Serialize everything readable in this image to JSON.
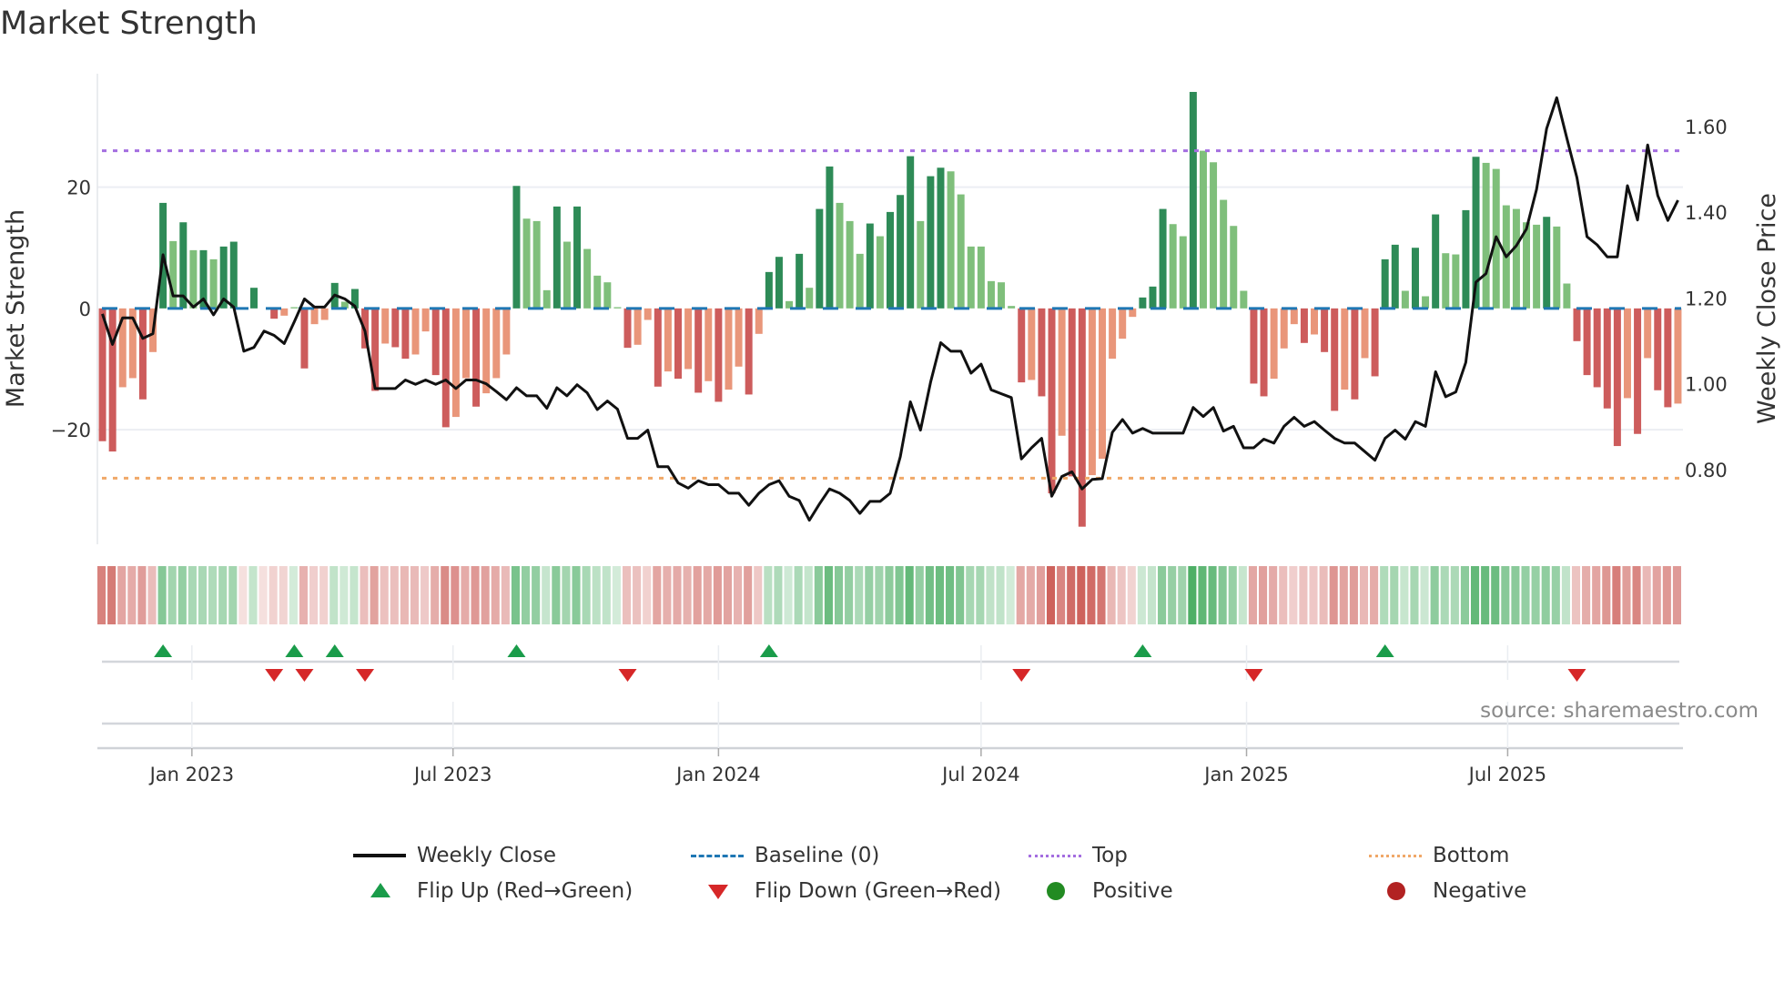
{
  "chart_data": {
    "type": "bar",
    "title": "Market Strength",
    "ylabel": "Market Strength",
    "ylabel_right": "Weekly Close Price",
    "x_start": "2022-10-31",
    "x_step_days": 7,
    "x_ticks": [
      {
        "label": "Jan 2023",
        "date": "2023-01-01"
      },
      {
        "label": "Jul 2023",
        "date": "2023-07-01"
      },
      {
        "label": "Jan 2024",
        "date": "2024-01-01"
      },
      {
        "label": "Jul 2024",
        "date": "2024-07-01"
      },
      {
        "label": "Jan 2025",
        "date": "2025-01-01"
      },
      {
        "label": "Jul 2025",
        "date": "2025-07-01"
      }
    ],
    "ylim": [
      -38.9,
      38.7
    ],
    "y_ticks": [
      {
        "value": 20,
        "label": "20"
      },
      {
        "value": 0,
        "label": "0"
      },
      {
        "value": -20,
        "label": "−20"
      }
    ],
    "ylim_right": [
      0.626,
      1.723
    ],
    "y_ticks_right": [
      {
        "value": 1.6,
        "label": "1.60"
      },
      {
        "value": 1.4,
        "label": "1.40"
      },
      {
        "value": 1.2,
        "label": "1.20"
      },
      {
        "value": 1.0,
        "label": "1.00"
      },
      {
        "value": 0.8,
        "label": "0.80"
      }
    ],
    "grid": true,
    "reference_lines": {
      "baseline": 0,
      "top": 26,
      "bottom": -28
    },
    "series": [
      {
        "name": "Market Strength",
        "values": [
          -21.9,
          -23.6,
          -13,
          -11.5,
          -15,
          -7.2,
          17.4,
          11.1,
          14.2,
          9.6,
          9.6,
          8.1,
          10.2,
          11,
          0,
          3.4,
          0,
          -1.7,
          -1.2,
          0.2,
          -9.9,
          -2.6,
          -1.9,
          4.2,
          1.1,
          3.2,
          -6.6,
          -13.6,
          -5.8,
          -6.4,
          -8.3,
          -7.6,
          -3.8,
          -11,
          -19.6,
          -17.9,
          -11.5,
          -16.2,
          -14,
          -11.5,
          -7.6,
          20.2,
          14.8,
          14.4,
          3,
          16.8,
          11,
          16.8,
          9.8,
          5.4,
          4.3,
          0.2,
          -6.5,
          -6,
          -1.9,
          -12.9,
          -10.4,
          -11.6,
          -10,
          -13.9,
          -12,
          -15.4,
          -13.4,
          -9.6,
          -14.2,
          -4.2,
          6,
          8.5,
          1.2,
          9,
          3.4,
          16.4,
          23.4,
          17.4,
          14.4,
          9,
          14,
          11.9,
          15.9,
          18.7,
          25.1,
          14.4,
          21.8,
          23.2,
          22.6,
          18.8,
          10.2,
          10.2,
          4.5,
          4.3,
          0.4,
          -12.2,
          -11.8,
          -14.5,
          -30.5,
          -21,
          -27.7,
          -36,
          -27.5,
          -24.8,
          -8.3,
          -5,
          -1.4,
          1.8,
          3.6,
          16.4,
          13.9,
          11.9,
          35.7,
          26,
          24.1,
          17.9,
          13.6,
          2.9,
          -12.4,
          -14.5,
          -11.6,
          -6.6,
          -2.6,
          -5.7,
          -4.3,
          -7.2,
          -16.9,
          -13.4,
          -15,
          -8.2,
          -11.2,
          8.1,
          10.5,
          2.9,
          10,
          2,
          15.5,
          9.1,
          8.9,
          16.2,
          25,
          24,
          23,
          17,
          16.4,
          14.2,
          13.8,
          15.1,
          13.5,
          4.1,
          -5.4,
          -11,
          -13,
          -16.5,
          -22.7,
          -14.8,
          -20.7,
          -8.2,
          -13.5,
          -16.3,
          -15.7
        ],
        "strong": [
          1,
          1,
          0,
          0,
          1,
          0,
          1,
          0,
          1,
          0,
          1,
          0,
          1,
          1,
          0,
          1,
          0,
          1,
          0,
          0,
          1,
          0,
          0,
          1,
          0,
          1,
          1,
          1,
          0,
          1,
          1,
          0,
          0,
          1,
          1,
          0,
          0,
          1,
          0,
          0,
          0,
          1,
          0,
          0,
          0,
          1,
          0,
          1,
          0,
          0,
          0,
          0,
          1,
          0,
          0,
          1,
          0,
          1,
          0,
          1,
          0,
          1,
          0,
          0,
          1,
          0,
          1,
          1,
          0,
          1,
          0,
          1,
          1,
          0,
          0,
          0,
          1,
          0,
          1,
          1,
          1,
          0,
          1,
          1,
          0,
          0,
          0,
          0,
          0,
          0,
          0,
          1,
          0,
          1,
          1,
          0,
          1,
          1,
          0,
          0,
          0,
          0,
          0,
          1,
          1,
          1,
          0,
          0,
          1,
          0,
          0,
          0,
          0,
          0,
          1,
          1,
          0,
          0,
          0,
          1,
          0,
          1,
          1,
          0,
          1,
          0,
          1,
          1,
          1,
          0,
          1,
          0,
          1,
          0,
          0,
          1,
          1,
          0,
          0,
          0,
          0,
          0,
          0,
          1,
          0,
          0,
          1,
          1,
          1,
          1,
          1,
          0,
          1,
          0,
          1,
          1,
          0
        ]
      },
      {
        "name": "Weekly Close",
        "values": [
          1.163,
          1.092,
          1.154,
          1.154,
          1.106,
          1.117,
          1.301,
          1.205,
          1.205,
          1.179,
          1.198,
          1.161,
          1.198,
          1.179,
          1.076,
          1.085,
          1.123,
          1.113,
          1.094,
          1.145,
          1.198,
          1.179,
          1.179,
          1.207,
          1.198,
          1.181,
          1.123,
          0.989,
          0.989,
          0.989,
          1.009,
          0.999,
          1.009,
          0.999,
          1.009,
          0.989,
          1.009,
          1.009,
          1.0,
          0.982,
          0.963,
          0.991,
          0.972,
          0.972,
          0.943,
          0.991,
          0.972,
          0.998,
          0.979,
          0.94,
          0.96,
          0.941,
          0.873,
          0.873,
          0.892,
          0.807,
          0.807,
          0.769,
          0.757,
          0.774,
          0.765,
          0.765,
          0.745,
          0.745,
          0.717,
          0.745,
          0.765,
          0.774,
          0.738,
          0.728,
          0.682,
          0.72,
          0.755,
          0.745,
          0.728,
          0.698,
          0.726,
          0.726,
          0.745,
          0.83,
          0.958,
          0.892,
          1.004,
          1.096,
          1.076,
          1.076,
          1.025,
          1.046,
          0.986,
          0.977,
          0.968,
          0.825,
          0.851,
          0.873,
          0.738,
          0.784,
          0.795,
          0.755,
          0.777,
          0.779,
          0.887,
          0.917,
          0.885,
          0.896,
          0.885,
          0.885,
          0.885,
          0.885,
          0.945,
          0.924,
          0.945,
          0.89,
          0.901,
          0.851,
          0.851,
          0.871,
          0.862,
          0.901,
          0.922,
          0.901,
          0.912,
          0.892,
          0.873,
          0.862,
          0.862,
          0.842,
          0.822,
          0.873,
          0.892,
          0.871,
          0.912,
          0.901,
          1.028,
          0.97,
          0.981,
          1.05,
          1.237,
          1.257,
          1.343,
          1.296,
          1.322,
          1.361,
          1.453,
          1.595,
          1.667,
          1.573,
          1.481,
          1.343,
          1.324,
          1.296,
          1.296,
          1.462,
          1.382,
          1.557,
          1.439,
          1.381,
          1.428
        ]
      }
    ],
    "legend": {
      "placement": "bottom",
      "items": [
        {
          "label": "Weekly Close",
          "symbol": "line-solid",
          "color": "#111111"
        },
        {
          "label": "Baseline (0)",
          "symbol": "line-dashed",
          "color": "#1f77b4"
        },
        {
          "label": "Top",
          "symbol": "line-dotted",
          "color": "#a46ee0"
        },
        {
          "label": "Bottom",
          "symbol": "line-dotted",
          "color": "#f0a868"
        },
        {
          "label": "Flip Up (Red→Green)",
          "symbol": "triangle-up",
          "color": "#1a9c4a"
        },
        {
          "label": "Flip Down (Green→Red)",
          "symbol": "triangle-down",
          "color": "#d62728"
        },
        {
          "label": "Positive",
          "symbol": "dot",
          "color": "#228b22"
        },
        {
          "label": "Negative",
          "symbol": "dot",
          "color": "#b22222"
        }
      ]
    },
    "colors": {
      "pos_strong": "#2e8b57",
      "pos_weak": "#7fbf7b",
      "neg_strong": "#cd5c5c",
      "neg_weak": "#e9967a",
      "price": "#111111",
      "baseline": "#1f77b4",
      "top": "#a46ee0",
      "bottom": "#f0a868",
      "flip_up": "#1a9c4a",
      "flip_down": "#d62728"
    },
    "annotation": "source: sharemaestro.com"
  }
}
